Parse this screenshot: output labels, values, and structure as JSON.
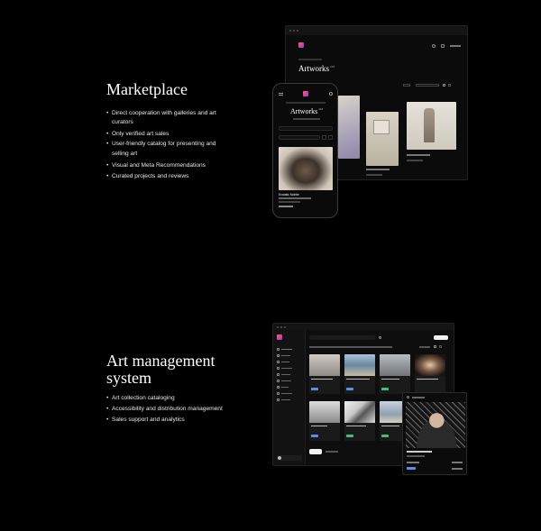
{
  "marketplace": {
    "title": "Marketplace",
    "bullets": [
      "Direct cooperation with galleries and art curators",
      "Only verified art sales",
      "User-friendly catalog for presenting and selling art",
      "Visual and Meta Recommendations",
      "Curated projects and reviews"
    ],
    "desktop": {
      "heading": "Artworks",
      "heading_count": "218"
    },
    "mobile": {
      "heading": "Artworks",
      "heading_count": "218",
      "card_title": "Ecstatic Mobile"
    }
  },
  "management": {
    "title_line1": "Art management",
    "title_line2": "system",
    "bullets": [
      "Art collection cataloging",
      "Accessibility and distribution management",
      "Sales support and analytics"
    ]
  },
  "colors": {
    "background": "#000000",
    "accent_orange": "#ff6a3d",
    "accent_pink": "#e23aa3",
    "accent_purple": "#6f4bff",
    "badge_blue": "#5b8def",
    "badge_green": "#3fbf7f"
  }
}
